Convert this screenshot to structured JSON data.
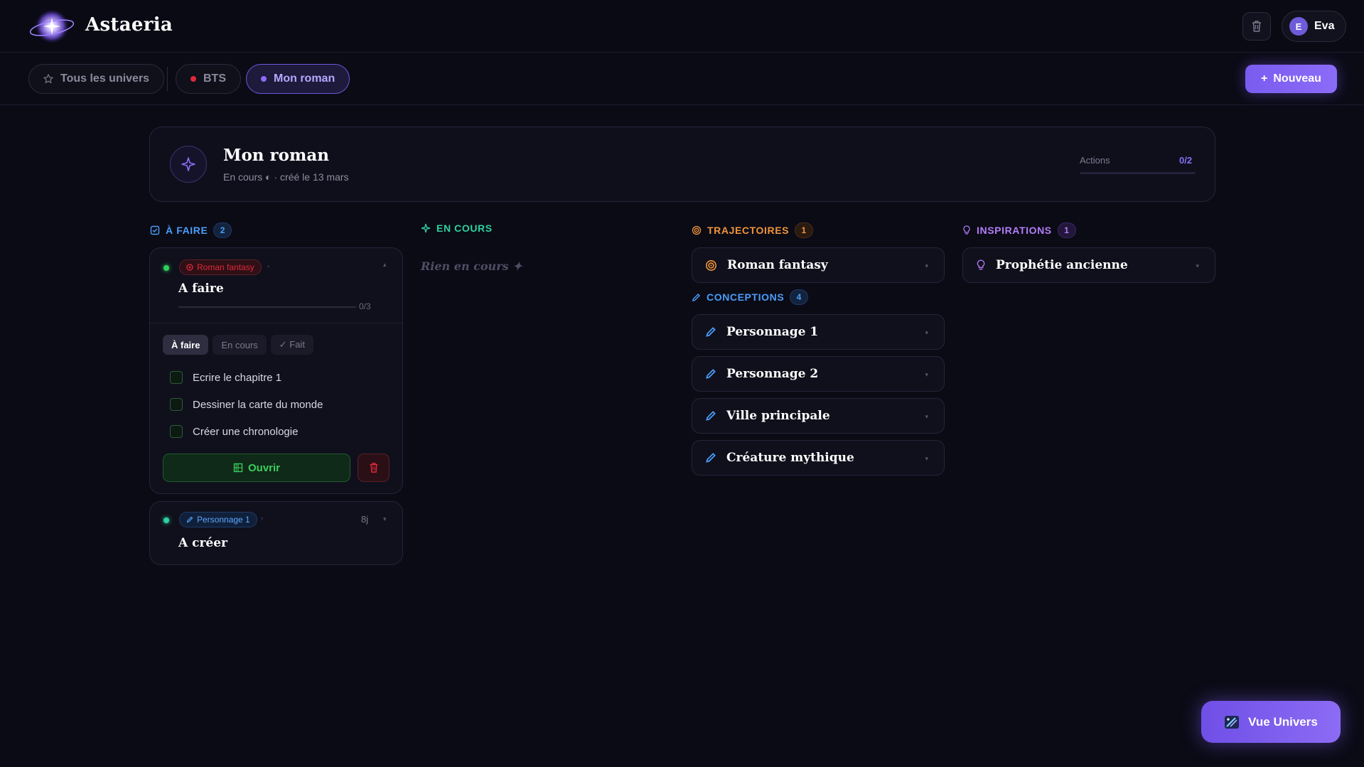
{
  "app": {
    "title": "Astaeria"
  },
  "user": {
    "initial": "E",
    "name": "Eva"
  },
  "tabs": [
    {
      "label": "Tous les univers"
    },
    {
      "label": "BTS",
      "color": "#e0283a"
    },
    {
      "label": "Mon roman",
      "color": "#8b6cf8"
    }
  ],
  "new_button": {
    "icon": "+",
    "label": "Nouveau"
  },
  "project": {
    "title": "Mon roman",
    "subtitle": "En cours ◐ · créé le 13 mars",
    "actions_label": "Actions",
    "actions_value": "0/2",
    "actions_progress": 0
  },
  "columns": {
    "todo": {
      "title": "À FAIRE",
      "count": "2",
      "color": "#4a9df8"
    },
    "inprogress": {
      "title": "EN COURS",
      "color": "#2fd0a0",
      "empty": "Rien en cours ✦"
    },
    "trajectories": {
      "title": "TRAJECTOIRES",
      "count": "1",
      "color": "#f0943a"
    },
    "conceptions": {
      "title": "CONCEPTIONS",
      "count": "4",
      "color": "#4a9df8"
    },
    "inspirations": {
      "title": "INSPIRATIONS",
      "count": "1",
      "color": "#b47cf8"
    }
  },
  "task1": {
    "badge": "Roman fantasy",
    "badge_color": "#e0283a",
    "title": "A faire",
    "progress": "0/3",
    "progress_fraction": 0,
    "subtabs": [
      "À faire",
      "En cours",
      "✓ Fait"
    ],
    "checklist": [
      "Ecrire le chapitre 1",
      "Dessiner la carte du monde",
      "Créer une chronologie"
    ],
    "open_label": "Ouvrir"
  },
  "task2": {
    "badge": "Personnage 1",
    "badge_color": "#4a9df8",
    "age": "8j",
    "title": "A créer"
  },
  "trajectories": [
    {
      "label": "Roman fantasy",
      "icon": "target-icon"
    }
  ],
  "conceptions": [
    {
      "label": "Personnage 1",
      "icon": "pen-icon"
    },
    {
      "label": "Personnage 2",
      "icon": "pen-icon"
    },
    {
      "label": "Ville principale",
      "icon": "pen-icon"
    },
    {
      "label": "Créature mythique",
      "icon": "pen-icon"
    }
  ],
  "inspirations": [
    {
      "label": "Prophétie ancienne",
      "icon": "lightbulb-icon"
    }
  ],
  "vue_button": {
    "label": "Vue Univers"
  }
}
